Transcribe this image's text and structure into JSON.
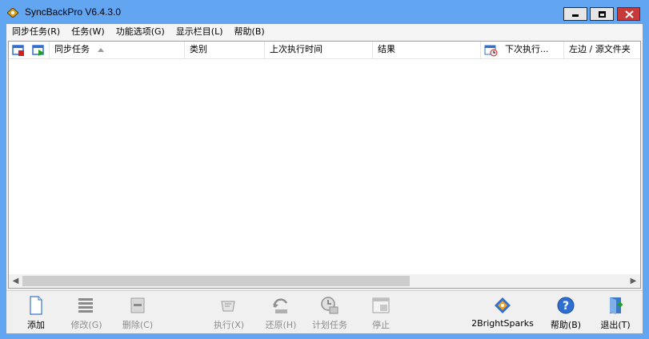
{
  "window": {
    "title": "SyncBackPro V6.4.3.0",
    "controls": {
      "minimize": "minimize",
      "maximize": "maximize",
      "close": "close"
    }
  },
  "menu": [
    {
      "label": "同步任务(R)"
    },
    {
      "label": "任务(W)"
    },
    {
      "label": "功能选项(G)"
    },
    {
      "label": "显示栏目(L)"
    },
    {
      "label": "帮助(B)"
    }
  ],
  "list": {
    "columns": [
      {
        "label": "同步任务",
        "sorted": "ascending"
      },
      {
        "label": "类别"
      },
      {
        "label": "上次执行时间"
      },
      {
        "label": "结果"
      },
      {
        "label": "下次执行..."
      },
      {
        "label": "左边 / 源文件夹"
      }
    ],
    "rows": []
  },
  "toolbar": {
    "add": "添加",
    "modify": "修改(G)",
    "delete": "删除(C)",
    "run": "执行(X)",
    "restore": "还原(H)",
    "schedule": "计划任务",
    "stop": "停止",
    "brand": "2BrightSparks",
    "help": "帮助(B)",
    "exit": "退出(T)"
  },
  "colors": {
    "frame": "#62a5f0",
    "close_button": "#c83a3a",
    "accent_blue": "#2f6fd0"
  }
}
